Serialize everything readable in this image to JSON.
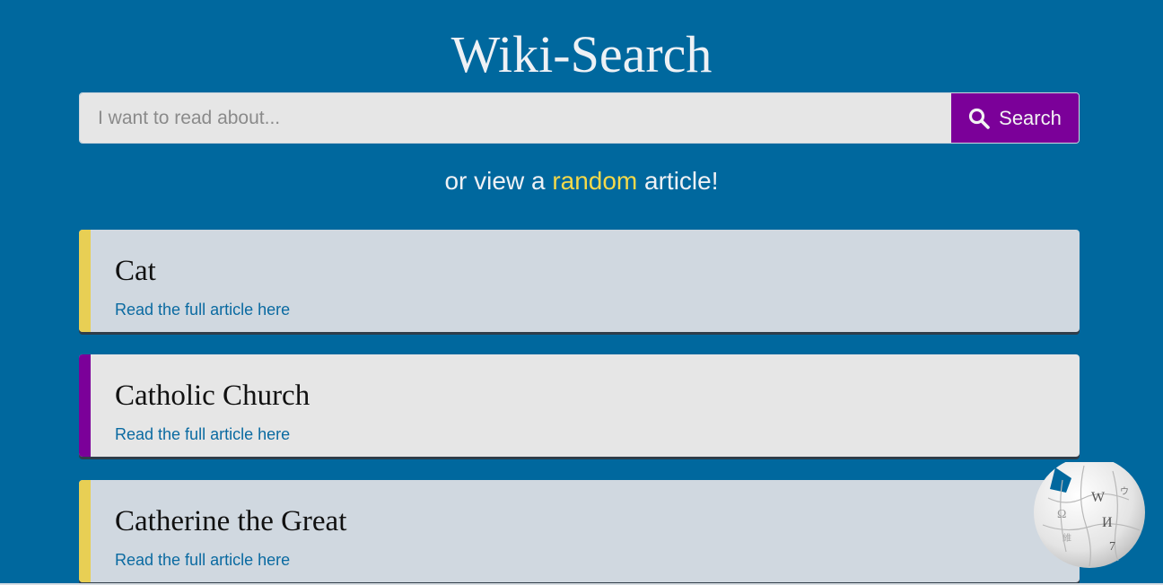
{
  "header": {
    "title": "Wiki-Search"
  },
  "search": {
    "placeholder": "I want to read about...",
    "value": "",
    "button_label": "Search",
    "button_icon": "search-icon"
  },
  "random": {
    "prefix": "or view a ",
    "link_label": "random",
    "suffix": " article!"
  },
  "results": [
    {
      "title": "Cat",
      "link_label": "Read the full article here",
      "accent": "#e8cf54",
      "background": "#d0d8e0"
    },
    {
      "title": "Catholic Church",
      "link_label": "Read the full article here",
      "accent": "#7b0099",
      "background": "#e6e6e6"
    },
    {
      "title": "Catherine the Great",
      "link_label": "Read the full article here",
      "accent": "#e8cf54",
      "background": "#d0d8e0"
    }
  ],
  "logo": {
    "icon": "wikipedia-globe-logo",
    "glyphs": [
      "W",
      "И",
      "Ω",
      "ウ",
      "7",
      "維"
    ]
  },
  "colors": {
    "page_background": "#00689e",
    "search_button": "#7b0099",
    "random_link": "#f4d94a",
    "article_link": "#0a6aa1"
  }
}
